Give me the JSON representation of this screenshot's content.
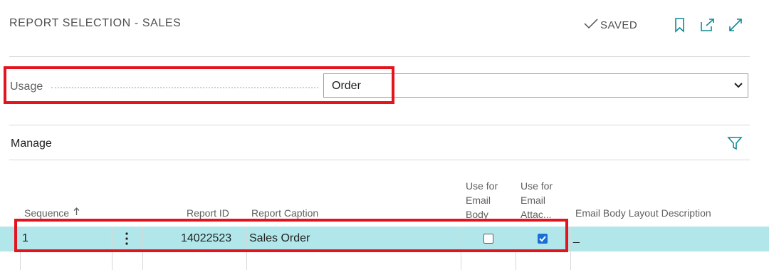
{
  "header": {
    "title": "REPORT SELECTION - SALES",
    "saved_label": "SAVED"
  },
  "usage": {
    "label": "Usage",
    "value": "Order"
  },
  "manage": {
    "label": "Manage"
  },
  "table": {
    "columns": {
      "sequence": "Sequence",
      "report_id": "Report ID",
      "report_caption": "Report Caption",
      "use_email_body_l1": "Use for",
      "use_email_body_l2": "Email",
      "use_email_body_l3": "Body",
      "use_email_attach_l1": "Use for",
      "use_email_attach_l2": "Email",
      "use_email_attach_l3": "Attac...",
      "email_body_layout": "Email Body Layout Description"
    },
    "rows": [
      {
        "sequence": "1",
        "report_id": "14022523",
        "report_caption": "Sales Order",
        "use_email_body": false,
        "use_email_attachment": true,
        "email_body_layout": "_"
      }
    ]
  },
  "colors": {
    "accent": "#0f8a96",
    "checkbox_checked": "#1a6fd6",
    "selected_row": "#b1e7ea",
    "highlight": "#e4141f"
  }
}
